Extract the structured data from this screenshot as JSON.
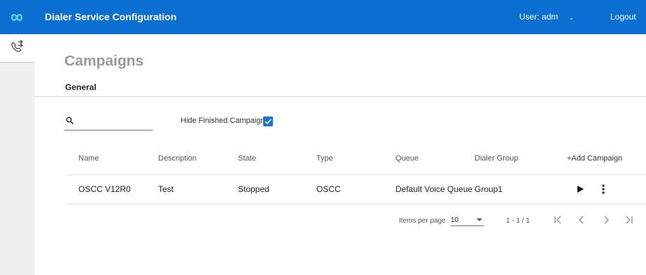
{
  "header": {
    "title": "Dialer Service Configuration",
    "user_label": "User:",
    "user_name": "adm",
    "logout_label": "Logout"
  },
  "page": {
    "title": "Campaigns",
    "tab_general": "General"
  },
  "filters": {
    "search_value": "",
    "hide_finished_label": "Hide Finished Campaigns",
    "hide_finished_checked": true
  },
  "table": {
    "columns": [
      "Name",
      "Description",
      "State",
      "Type",
      "Queue",
      "Dialer Group"
    ],
    "add_campaign_label": "+Add Campaign",
    "rows": [
      {
        "name": "OSCC V12R0",
        "description": "Test",
        "state": "Stopped",
        "type": "OSCC",
        "queue": "Default Voice Queue",
        "dialer_group": "Group1"
      }
    ]
  },
  "pagination": {
    "items_per_page_label": "Items per page",
    "items_per_page_value": "10",
    "range_label": "1 - 1 / 1"
  },
  "colors": {
    "header_bg": "#0a6fd0",
    "accent": "#1a73d6",
    "rail_bg": "#efefef"
  }
}
